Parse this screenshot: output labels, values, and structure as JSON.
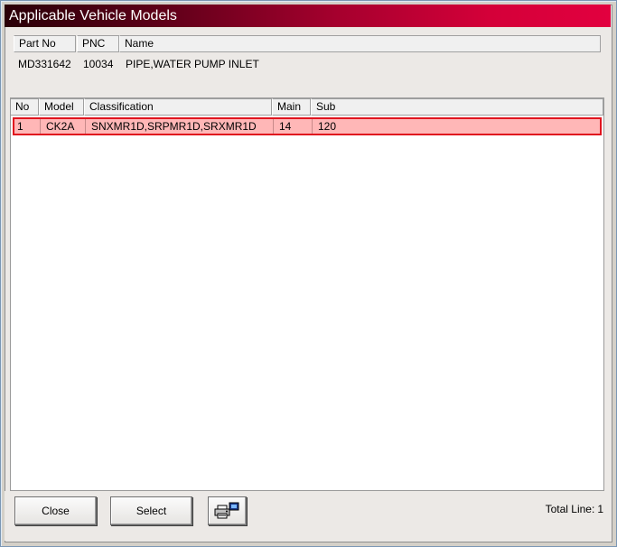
{
  "window": {
    "title": "Applicable Vehicle Models"
  },
  "part_info": {
    "headers": {
      "part_no": "Part No",
      "pnc": "PNC",
      "name": "Name"
    },
    "values": {
      "part_no": "MD331642",
      "pnc": "10034",
      "name": "PIPE,WATER PUMP INLET"
    }
  },
  "models_table": {
    "headers": {
      "no": "No",
      "model": "Model",
      "classification": "Classification",
      "main": "Main",
      "sub": "Sub"
    },
    "rows": [
      {
        "no": "1",
        "model": "CK2A",
        "classification": "SNXMR1D,SRPMR1D,SRXMR1D",
        "main": "14",
        "sub": "120"
      }
    ]
  },
  "footer": {
    "close_label": "Close",
    "select_label": "Select",
    "print_icon": "print-icon",
    "total_label": "Total Line:",
    "total_value": "1"
  },
  "colors": {
    "title_gradient_start": "#2a0008",
    "title_gradient_end": "#e2003f",
    "selected_row_fill": "#ffb7b7",
    "selected_row_border": "#e0141e"
  }
}
